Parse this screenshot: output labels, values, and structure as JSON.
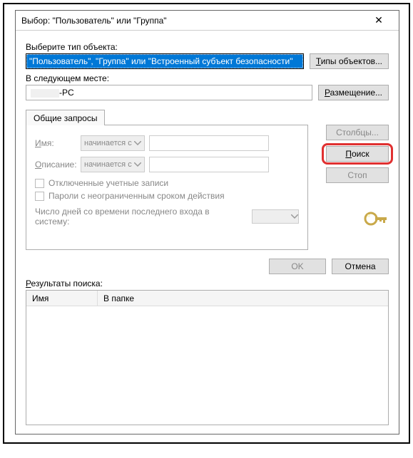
{
  "window": {
    "title": "Выбор: \"Пользователь\" или \"Группа\"",
    "close": "✕"
  },
  "objectType": {
    "label": "Выберите тип объекта:",
    "value": "\"Пользователь\", \"Группа\" или \"Встроенный субъект безопасности\"",
    "button": "Типы объектов..."
  },
  "location": {
    "label": "В следующем месте:",
    "suffix": "-PC",
    "button": "Размещение..."
  },
  "tabs": {
    "common": "Общие запросы"
  },
  "query": {
    "nameLabel": "Имя:",
    "descLabel": "Описание:",
    "comboText": "начинается с",
    "chkDisabled": "Отключенные учетные записи",
    "chkPassword": "Пароли с неограниченным сроком действия",
    "daysLabel": "Число дней со времени последнего входа в систему:"
  },
  "sideButtons": {
    "columns": "Столбцы...",
    "search": "Поиск",
    "stop": "Стоп"
  },
  "footer": {
    "ok": "OK",
    "cancel": "Отмена"
  },
  "results": {
    "label": "Результаты поиска:",
    "colName": "Имя",
    "colFolder": "В папке"
  }
}
